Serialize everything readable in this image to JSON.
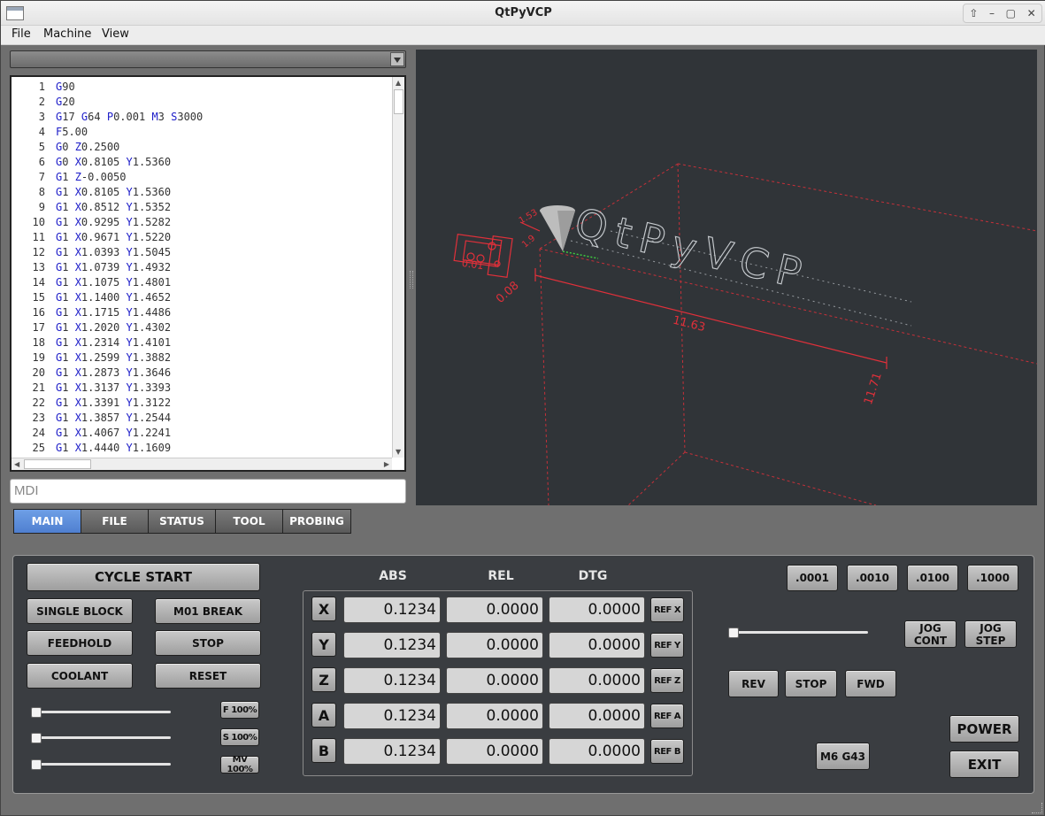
{
  "window": {
    "title": "QtPyVCP"
  },
  "menu": [
    "File",
    "Machine",
    "View"
  ],
  "window_buttons": [
    "⇧",
    "–",
    "▢",
    "✕"
  ],
  "gcode": [
    {
      "n": "1",
      "t": [
        [
          "G",
          "90"
        ]
      ]
    },
    {
      "n": "2",
      "t": [
        [
          "G",
          "20"
        ]
      ]
    },
    {
      "n": "3",
      "t": [
        [
          "G",
          "17 "
        ],
        [
          "G",
          "64 "
        ],
        [
          "P",
          "0.001 "
        ],
        [
          "M",
          "3 "
        ],
        [
          "S",
          "3000"
        ]
      ]
    },
    {
      "n": "4",
      "t": [
        [
          "F",
          "5.00"
        ]
      ]
    },
    {
      "n": "5",
      "t": [
        [
          "G",
          "0 "
        ],
        [
          "Z",
          "0.2500"
        ]
      ]
    },
    {
      "n": "6",
      "t": [
        [
          "G",
          "0 "
        ],
        [
          "X",
          "0.8105 "
        ],
        [
          "Y",
          "1.5360"
        ]
      ]
    },
    {
      "n": "7",
      "t": [
        [
          "G",
          "1 "
        ],
        [
          "Z",
          "-0.0050"
        ]
      ]
    },
    {
      "n": "8",
      "t": [
        [
          "G",
          "1 "
        ],
        [
          "X",
          "0.8105 "
        ],
        [
          "Y",
          "1.5360"
        ]
      ]
    },
    {
      "n": "9",
      "t": [
        [
          "G",
          "1 "
        ],
        [
          "X",
          "0.8512 "
        ],
        [
          "Y",
          "1.5352"
        ]
      ]
    },
    {
      "n": "10",
      "t": [
        [
          "G",
          "1 "
        ],
        [
          "X",
          "0.9295 "
        ],
        [
          "Y",
          "1.5282"
        ]
      ]
    },
    {
      "n": "11",
      "t": [
        [
          "G",
          "1 "
        ],
        [
          "X",
          "0.9671 "
        ],
        [
          "Y",
          "1.5220"
        ]
      ]
    },
    {
      "n": "12",
      "t": [
        [
          "G",
          "1 "
        ],
        [
          "X",
          "1.0393 "
        ],
        [
          "Y",
          "1.5045"
        ]
      ]
    },
    {
      "n": "13",
      "t": [
        [
          "G",
          "1 "
        ],
        [
          "X",
          "1.0739 "
        ],
        [
          "Y",
          "1.4932"
        ]
      ]
    },
    {
      "n": "14",
      "t": [
        [
          "G",
          "1 "
        ],
        [
          "X",
          "1.1075 "
        ],
        [
          "Y",
          "1.4801"
        ]
      ]
    },
    {
      "n": "15",
      "t": [
        [
          "G",
          "1 "
        ],
        [
          "X",
          "1.1400 "
        ],
        [
          "Y",
          "1.4652"
        ]
      ]
    },
    {
      "n": "16",
      "t": [
        [
          "G",
          "1 "
        ],
        [
          "X",
          "1.1715 "
        ],
        [
          "Y",
          "1.4486"
        ]
      ]
    },
    {
      "n": "17",
      "t": [
        [
          "G",
          "1 "
        ],
        [
          "X",
          "1.2020 "
        ],
        [
          "Y",
          "1.4302"
        ]
      ]
    },
    {
      "n": "18",
      "t": [
        [
          "G",
          "1 "
        ],
        [
          "X",
          "1.2314 "
        ],
        [
          "Y",
          "1.4101"
        ]
      ]
    },
    {
      "n": "19",
      "t": [
        [
          "G",
          "1 "
        ],
        [
          "X",
          "1.2599 "
        ],
        [
          "Y",
          "1.3882"
        ]
      ]
    },
    {
      "n": "20",
      "t": [
        [
          "G",
          "1 "
        ],
        [
          "X",
          "1.2873 "
        ],
        [
          "Y",
          "1.3646"
        ]
      ]
    },
    {
      "n": "21",
      "t": [
        [
          "G",
          "1 "
        ],
        [
          "X",
          "1.3137 "
        ],
        [
          "Y",
          "1.3393"
        ]
      ]
    },
    {
      "n": "22",
      "t": [
        [
          "G",
          "1 "
        ],
        [
          "X",
          "1.3391 "
        ],
        [
          "Y",
          "1.3122"
        ]
      ]
    },
    {
      "n": "23",
      "t": [
        [
          "G",
          "1 "
        ],
        [
          "X",
          "1.3857 "
        ],
        [
          "Y",
          "1.2544"
        ]
      ]
    },
    {
      "n": "24",
      "t": [
        [
          "G",
          "1 "
        ],
        [
          "X",
          "1.4067 "
        ],
        [
          "Y",
          "1.2241"
        ]
      ]
    },
    {
      "n": "25",
      "t": [
        [
          "G",
          "1 "
        ],
        [
          "X",
          "1.4440 "
        ],
        [
          "Y",
          "1.1609"
        ]
      ]
    }
  ],
  "mdi": {
    "placeholder": "MDI"
  },
  "backplot": {
    "logo_text": "QtPyVCP",
    "dims": {
      "x_len": "11.63",
      "y_len": "11.71",
      "z_small": "0.08",
      "c1": "1.53",
      "c2": "1.9",
      "c3": "0.01"
    }
  },
  "tabs": [
    {
      "label": "MAIN",
      "active": true
    },
    {
      "label": "FILE"
    },
    {
      "label": "STATUS"
    },
    {
      "label": "TOOL"
    },
    {
      "label": "PROBING"
    }
  ],
  "controls": {
    "cycle_start": "CYCLE START",
    "single_block": "SINGLE BLOCK",
    "m01_break": "M01 BREAK",
    "feedhold": "FEEDHOLD",
    "stop": "STOP",
    "coolant": "COOLANT",
    "reset": "RESET",
    "feed_override": "F 100%",
    "spindle_override": "S 100%",
    "rapid_override": "MV 100%"
  },
  "dro": {
    "headers": [
      "ABS",
      "REL",
      "DTG"
    ],
    "axes": [
      {
        "axis": "X",
        "abs": "0.1234",
        "rel": "0.0000",
        "dtg": "0.0000",
        "ref": "REF X"
      },
      {
        "axis": "Y",
        "abs": "0.1234",
        "rel": "0.0000",
        "dtg": "0.0000",
        "ref": "REF Y"
      },
      {
        "axis": "Z",
        "abs": "0.1234",
        "rel": "0.0000",
        "dtg": "0.0000",
        "ref": "REF Z"
      },
      {
        "axis": "A",
        "abs": "0.1234",
        "rel": "0.0000",
        "dtg": "0.0000",
        "ref": "REF A"
      },
      {
        "axis": "B",
        "abs": "0.1234",
        "rel": "0.0000",
        "dtg": "0.0000",
        "ref": "REF B"
      }
    ]
  },
  "jog": {
    "increments": [
      ".0001",
      ".0010",
      ".0100",
      ".1000"
    ],
    "jog_cont": "JOG CONT",
    "jog_step": "JOG STEP"
  },
  "spindle": {
    "rev": "REV",
    "stop": "STOP",
    "fwd": "FWD"
  },
  "misc": {
    "m6_g43": "M6 G43",
    "power": "POWER",
    "exit": "EXIT"
  },
  "colors": {
    "accent_tab": "#5b8ad8",
    "gcode_word": "#1c1cc8",
    "backplot_bg": "#303438",
    "plot_red": "#e0303a"
  }
}
